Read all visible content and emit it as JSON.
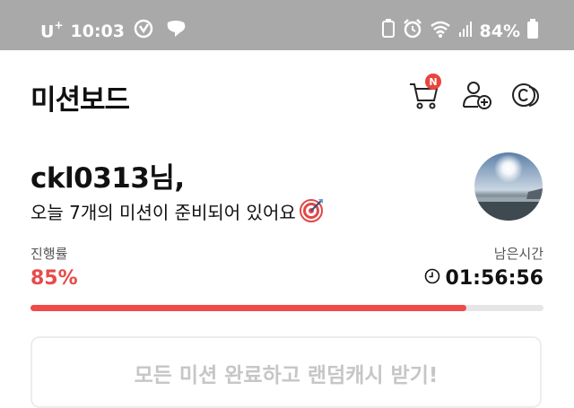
{
  "status_bar": {
    "carrier": "U",
    "carrier_sup": "+",
    "time": "10:03",
    "battery_percent": "84%"
  },
  "header": {
    "title": "미션보드",
    "cart_badge": "N",
    "icons": [
      "cart-icon",
      "add-friend-icon",
      "coin-icon"
    ]
  },
  "greeting": {
    "username_line": "ckl0313님,",
    "subtitle": "오늘 7개의 미션이 준비되어 있어요"
  },
  "progress": {
    "label": "진행률",
    "value": "85%",
    "fraction": 0.85,
    "remaining_label": "남은시간",
    "remaining_value": "01:56:56"
  },
  "reward": {
    "button_label": "모든 미션 완료하고 랜덤캐시 받기!"
  },
  "colors": {
    "accent": "#ef4b4b",
    "status_bar": "#a9a9a9",
    "disabled_text": "#c6c6c6"
  }
}
